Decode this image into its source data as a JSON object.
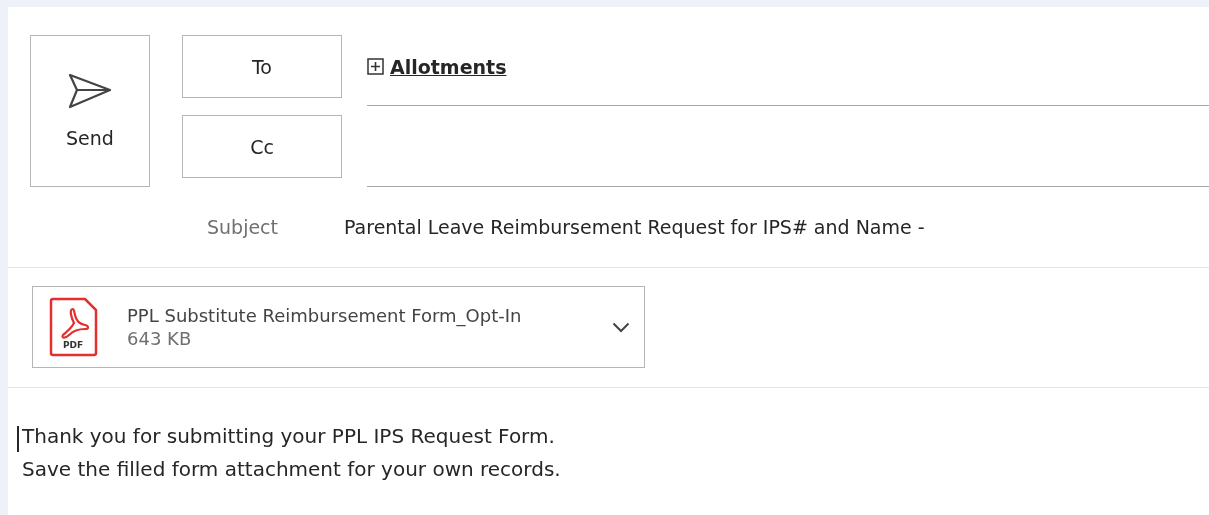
{
  "send_button": {
    "label": "Send"
  },
  "recipient_buttons": [
    {
      "label": "To"
    },
    {
      "label": "Cc"
    }
  ],
  "to_recipients": [
    {
      "name": "Allotments",
      "expandable": true
    }
  ],
  "subject": {
    "label": "Subject",
    "value": "Parental Leave Reimbursement Request for IPS# and Name -"
  },
  "attachments": [
    {
      "name": "PPL Substitute Reimbursement Form_Opt-In",
      "size": "643 KB",
      "badge": "PDF"
    }
  ],
  "body": {
    "lines": [
      "Thank you for submitting your PPL IPS Request Form.",
      "Save the filled form attachment for your own records."
    ]
  }
}
